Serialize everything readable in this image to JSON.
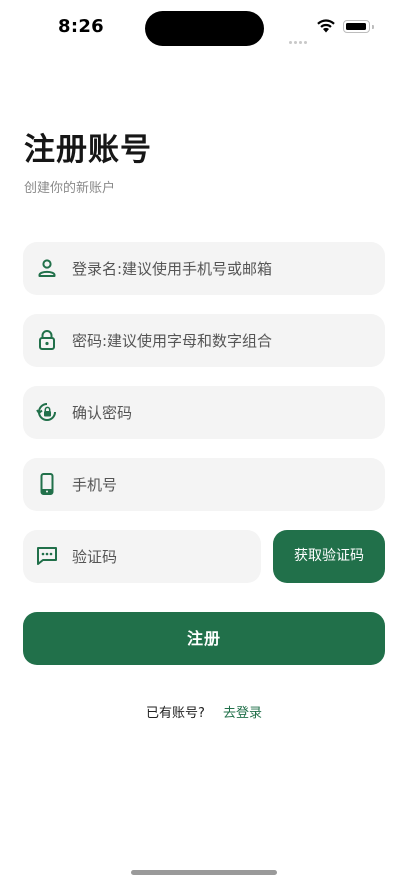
{
  "status_bar": {
    "time": "8:26"
  },
  "header": {
    "title": "注册账号",
    "subtitle": "创建你的新账户"
  },
  "form": {
    "username": {
      "placeholder": "登录名:建议使用手机号或邮箱",
      "value": "",
      "icon": "person-icon"
    },
    "password": {
      "placeholder": "密码:建议使用字母和数字组合",
      "value": "",
      "icon": "lock-icon"
    },
    "confirm_password": {
      "placeholder": "确认密码",
      "value": "",
      "icon": "lock-reset-icon"
    },
    "phone": {
      "placeholder": "手机号",
      "value": "",
      "icon": "phone-icon"
    },
    "verification_code": {
      "placeholder": "验证码",
      "value": "",
      "icon": "message-icon"
    },
    "get_code_label": "获取验证码",
    "submit_label": "注册"
  },
  "footer": {
    "question": "已有账号?",
    "login_link": "去登录"
  },
  "colors": {
    "accent": "#21704a",
    "field_bg": "#f4f4f4"
  }
}
